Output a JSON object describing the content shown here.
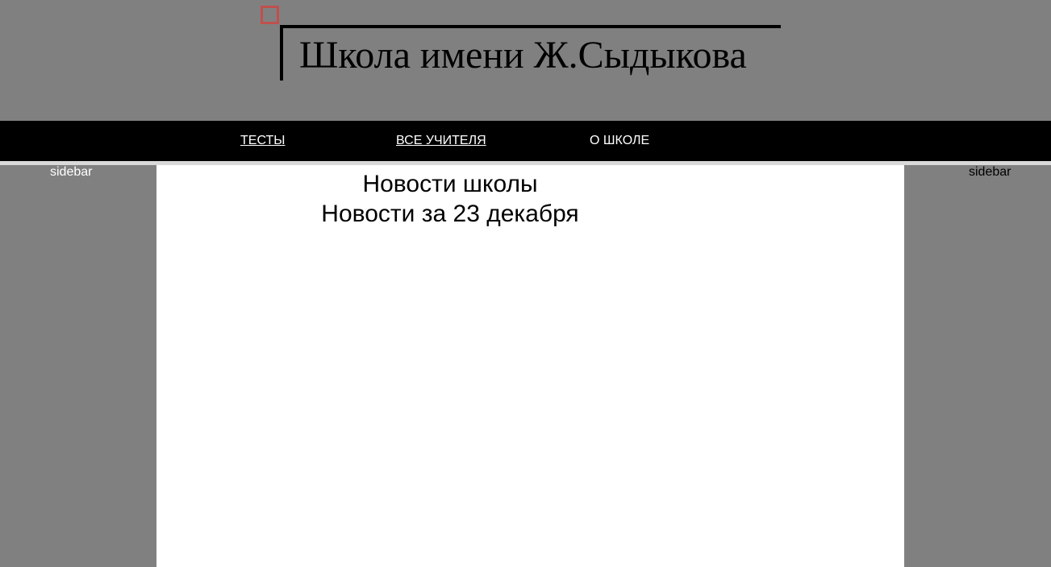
{
  "header": {
    "title": "Школа имени Ж.Сыдыкова"
  },
  "nav": {
    "items": [
      {
        "label": "ТЕСТЫ"
      },
      {
        "label": "ВСЕ УЧИТЕЛЯ"
      },
      {
        "label": "О ШКОЛЕ"
      }
    ]
  },
  "sidebars": {
    "left_label": "sidebar",
    "right_label": "sidebar"
  },
  "main": {
    "heading": "Новости школы",
    "subheading": "Новости за 23 декабря"
  },
  "colors": {
    "background": "#808080",
    "navbar": "#000000",
    "accent_square": "#c0504d",
    "content": "#ffffff"
  }
}
